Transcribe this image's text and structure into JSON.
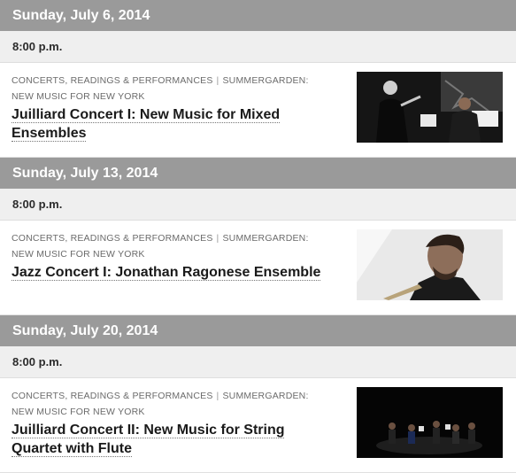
{
  "days": [
    {
      "date": "Sunday, July 6, 2014",
      "time": "8:00 p.m.",
      "event": {
        "category": "CONCERTS, READINGS & PERFORMANCES",
        "series": "SUMMERGARDEN: NEW MUSIC FOR NEW YORK",
        "title": "Juilliard Concert I: New Music for Mixed Ensembles"
      }
    },
    {
      "date": "Sunday, July 13, 2014",
      "time": "8:00 p.m.",
      "event": {
        "category": "CONCERTS, READINGS & PERFORMANCES",
        "series": "SUMMERGARDEN: NEW MUSIC FOR NEW YORK",
        "title": "Jazz Concert I: Jonathan Ragonese Ensemble"
      }
    },
    {
      "date": "Sunday, July 20, 2014",
      "time": "8:00 p.m.",
      "event": {
        "category": "CONCERTS, READINGS & PERFORMANCES",
        "series": "SUMMERGARDEN: NEW MUSIC FOR NEW YORK",
        "title": "Juilliard Concert II: New Music for String Quartet with Flute"
      }
    }
  ],
  "colors": {
    "date_bar": "#9a9a9a",
    "time_bar": "#efefef",
    "title_text": "#1a1a1a",
    "meta_text": "#6b6b6b"
  }
}
